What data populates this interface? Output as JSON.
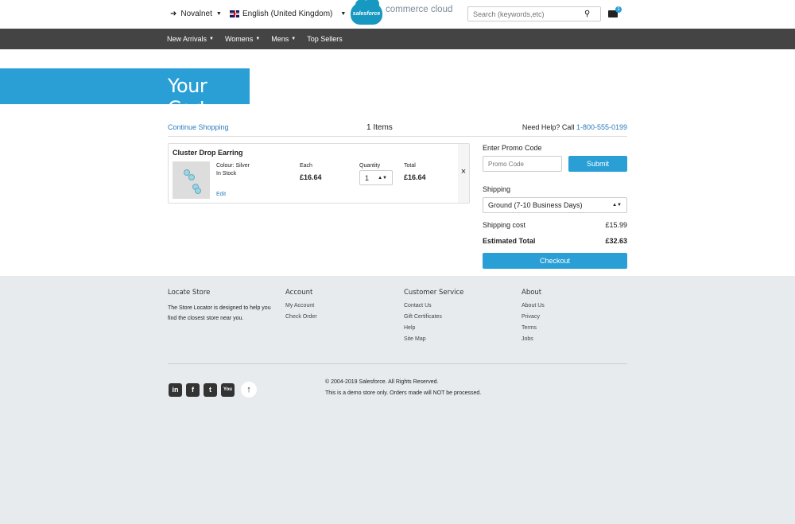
{
  "header": {
    "login_label": "Novalnet",
    "language_label": "English (United Kingdom)",
    "logo_mark": "salesforce",
    "logo_text": "commerce cloud",
    "search_placeholder": "Search (keywords,etc)",
    "cart_count": "1"
  },
  "nav": {
    "items": [
      {
        "label": "New Arrivals",
        "dropdown": true
      },
      {
        "label": "Womens",
        "dropdown": true
      },
      {
        "label": "Mens",
        "dropdown": true
      },
      {
        "label": "Top Sellers",
        "dropdown": false
      }
    ]
  },
  "banner": {
    "title": "Your Cart"
  },
  "cart_header": {
    "continue_label": "Continue Shopping",
    "item_count": "1 Items",
    "help_prefix": "Need Help? Call",
    "help_phone": "1-800-555-0199"
  },
  "product": {
    "name": "Cluster Drop Earring",
    "colour": "Colour: Silver",
    "stock": "In Stock",
    "edit_label": "Edit",
    "each_label": "Each",
    "each_price": "£16.64",
    "qty_label": "Quantity",
    "qty_value": "1",
    "total_label": "Total",
    "total_price": "£16.64",
    "remove_glyph": "×"
  },
  "summary": {
    "promo_label": "Enter Promo Code",
    "promo_placeholder": "Promo Code",
    "submit_label": "Submit",
    "shipping_label": "Shipping",
    "shipping_method": "Ground (7-10 Business Days)",
    "shipping_cost_label": "Shipping cost",
    "shipping_cost": "£15.99",
    "estimated_total_label": "Estimated Total",
    "estimated_total": "£32.63",
    "checkout_label": "Checkout"
  },
  "footer": {
    "locate": {
      "title": "Locate Store",
      "text": "The Store Locator is designed to help you find the closest store near you."
    },
    "account": {
      "title": "Account",
      "links": [
        "My Account",
        "Check Order"
      ]
    },
    "service": {
      "title": "Customer Service",
      "links": [
        "Contact Us",
        "Gift Certificates",
        "Help",
        "Site Map"
      ]
    },
    "about": {
      "title": "About",
      "links": [
        "About Us",
        "Privacy",
        "Terms",
        "Jobs"
      ]
    },
    "social": [
      "linkedin-icon",
      "facebook-icon",
      "twitter-icon",
      "youtube-icon"
    ],
    "copyright": "© 2004-2019 Salesforce. All Rights Reserved.",
    "disclaimer": "This is a demo store only. Orders made will NOT be processed."
  }
}
